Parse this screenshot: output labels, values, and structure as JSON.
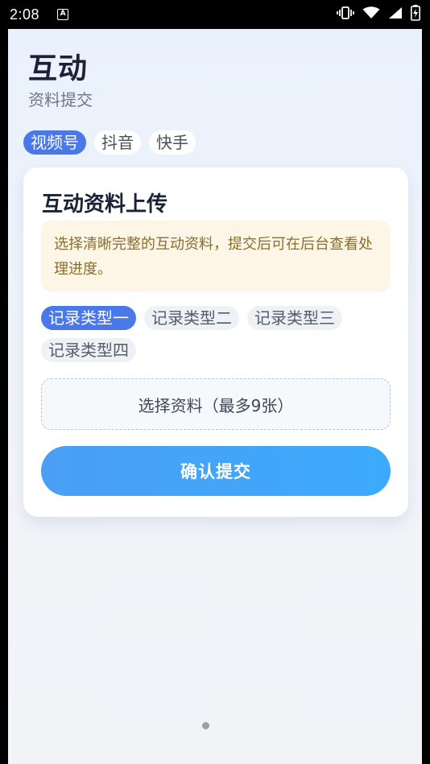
{
  "status_bar": {
    "time": "2:08",
    "notification_icon": "a-notification-icon",
    "icons": [
      "vibrate-icon",
      "wifi-icon",
      "signal-icon",
      "battery-charging-icon"
    ]
  },
  "header": {
    "title": "互动",
    "subtitle": "资料提交"
  },
  "platform_tabs": [
    {
      "label": "视频号",
      "active": true
    },
    {
      "label": "抖音",
      "active": false
    },
    {
      "label": "快手",
      "active": false
    }
  ],
  "card": {
    "title": "互动资料上传",
    "notice": "选择清晰完整的互动资料，提交后可在后台查看处理进度。",
    "record_types": [
      {
        "label": "记录类型一",
        "active": true
      },
      {
        "label": "记录类型二",
        "active": false
      },
      {
        "label": "记录类型三",
        "active": false
      },
      {
        "label": "记录类型四",
        "active": false
      }
    ],
    "pick_label": "选择资料（最多9张）",
    "confirm_label": "确认提交"
  },
  "colors": {
    "accent": "#4a78e8",
    "button_gradient_start": "#4a9ff5",
    "button_gradient_end": "#3caafb",
    "notice_bg": "#fdf6e6",
    "notice_text": "#8a6d2e"
  }
}
